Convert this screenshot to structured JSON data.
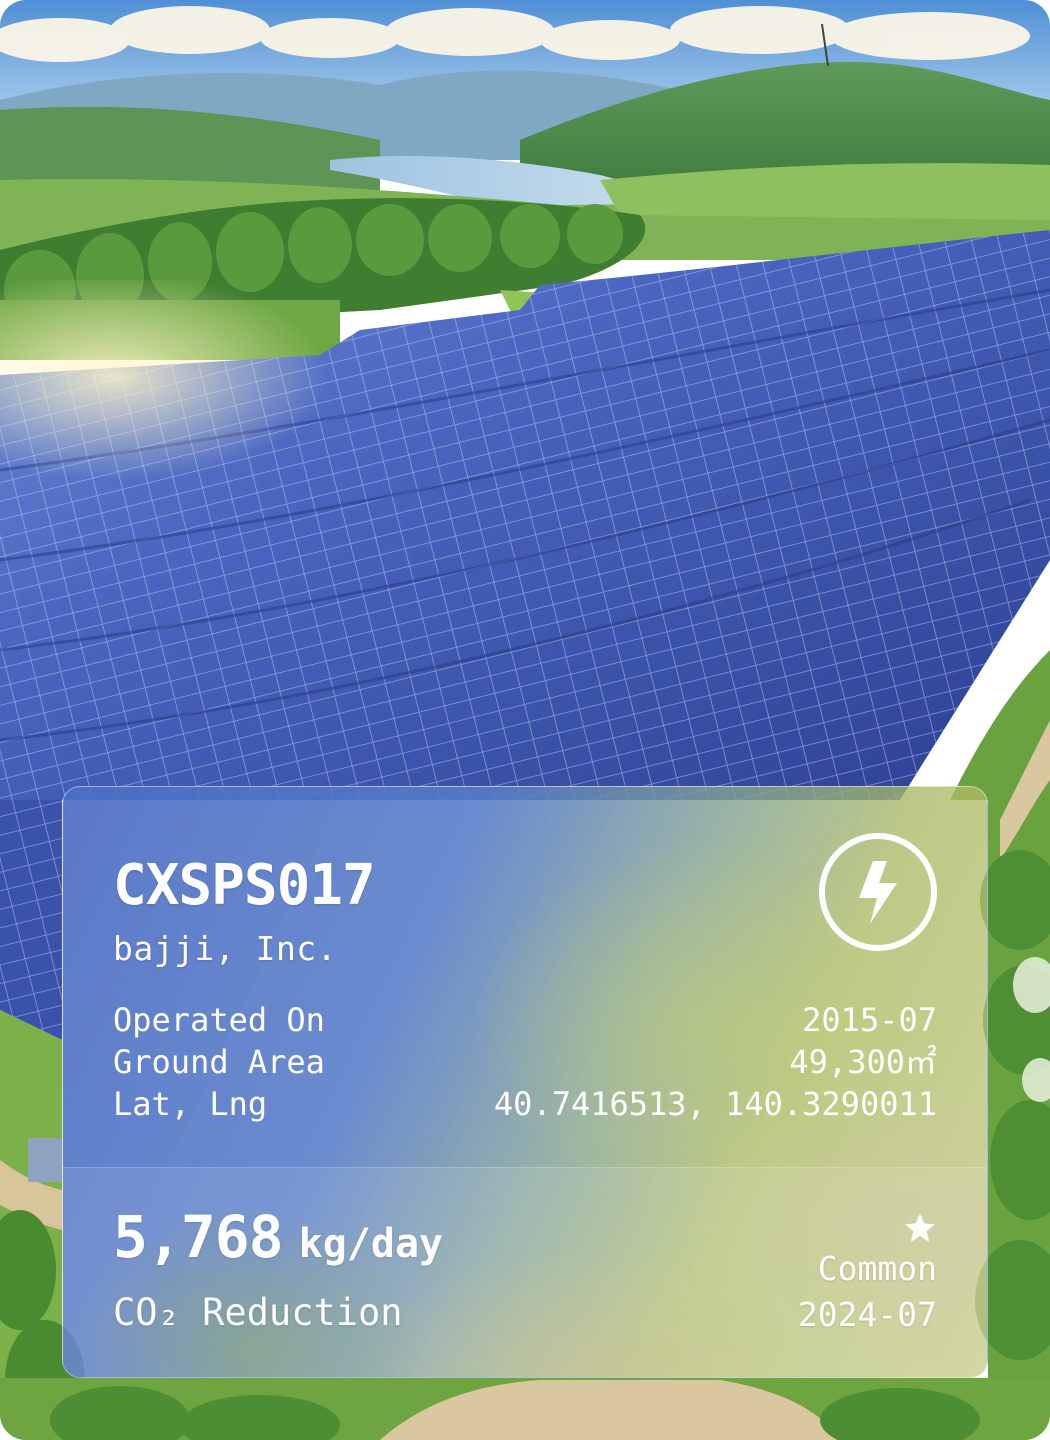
{
  "station": {
    "code": "CXSPS017",
    "company": "bajji, Inc.",
    "icon": "lightning-bolt-icon"
  },
  "details": [
    {
      "label": "Operated On",
      "value": "2015-07"
    },
    {
      "label": "Ground Area",
      "value": "49,300㎡"
    },
    {
      "label": "Lat, Lng",
      "value": "40.7416513, 140.3290011"
    }
  ],
  "metric": {
    "value": "5,768",
    "unit": "kg/day",
    "label": "CO₂ Reduction"
  },
  "card": {
    "rarity_icon": "star-icon",
    "rarity": "Common",
    "date": "2024-07"
  },
  "colors": {
    "panel_blue": "#4e6ec4",
    "panel_green": "#bec478",
    "text": "#ffffff"
  }
}
